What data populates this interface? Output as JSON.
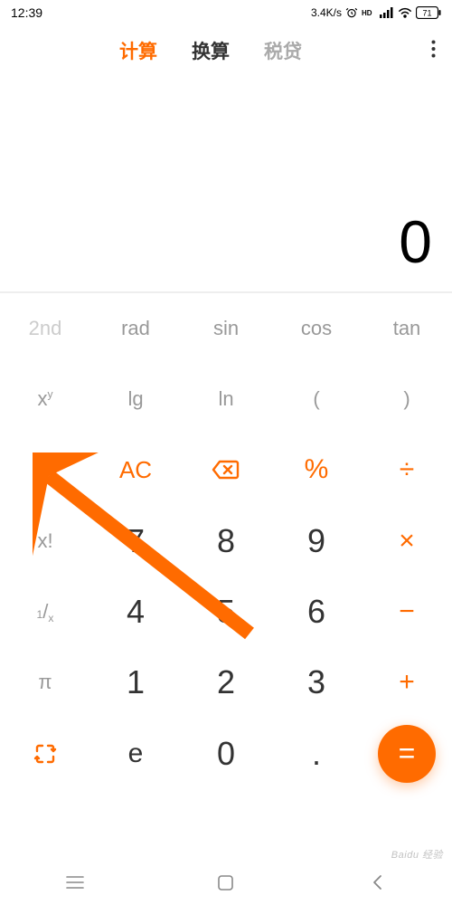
{
  "status": {
    "time": "12:39",
    "speed": "3.4K/s",
    "battery": "71"
  },
  "tabs": {
    "calculate": "计算",
    "convert": "换算",
    "tax": "税贷"
  },
  "display": {
    "value": "0"
  },
  "keys": {
    "second": "2nd",
    "rad": "rad",
    "sin": "sin",
    "cos": "cos",
    "tan": "tan",
    "lg": "lg",
    "ln": "ln",
    "lparen": "(",
    "rparen": ")",
    "ac": "AC",
    "percent": "%",
    "divide": "÷",
    "multiply": "×",
    "minus": "−",
    "plus": "+",
    "equals": "=",
    "pi": "π",
    "e": "e",
    "dot": ".",
    "n0": "0",
    "n1": "1",
    "n2": "2",
    "n3": "3",
    "n4": "4",
    "n5": "5",
    "n6": "6",
    "n7": "7",
    "n8": "8",
    "n9": "9"
  },
  "watermark": "Baidu 经验"
}
